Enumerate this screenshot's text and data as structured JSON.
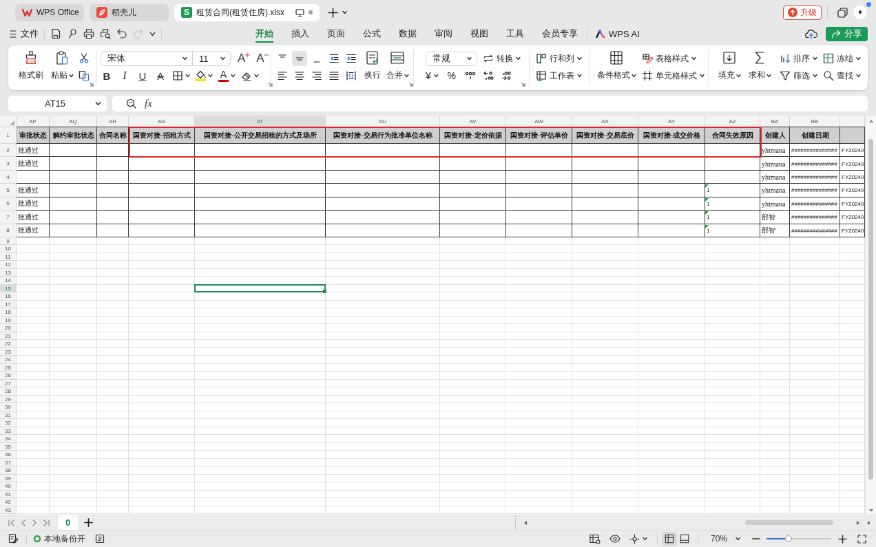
{
  "app_tabs": [
    {
      "kind": "wps",
      "label": "WPS Office",
      "selected": false
    },
    {
      "kind": "docer",
      "label": "稻壳儿",
      "selected": false
    },
    {
      "kind": "sheet",
      "icon_text": "S",
      "label": "租赁合同(租赁住房).xlsx",
      "selected": true
    }
  ],
  "account": {
    "upgrade": "升级"
  },
  "menu": {
    "file": "文件",
    "redo_disabled": true,
    "tabs": [
      {
        "label": "开始",
        "selected": true
      },
      {
        "label": "插入",
        "selected": false
      },
      {
        "label": "页面",
        "selected": false
      },
      {
        "label": "公式",
        "selected": false
      },
      {
        "label": "数据",
        "selected": false
      },
      {
        "label": "审阅",
        "selected": false
      },
      {
        "label": "视图",
        "selected": false
      },
      {
        "label": "工具",
        "selected": false
      },
      {
        "label": "会员专享",
        "selected": false
      }
    ],
    "ai": "WPS AI",
    "share": "分享"
  },
  "ribbon": {
    "format_painter": "格式刷",
    "paste": "粘贴",
    "font_name": "宋体",
    "font_size": "11",
    "grow_font": "A",
    "shrink_font": "A",
    "bold": "B",
    "italic": "I",
    "underline": "U",
    "strikethrough": "A",
    "font_color": "A",
    "vertical_align": [
      {
        "kind": "top",
        "selected": false
      },
      {
        "kind": "middle",
        "selected": true
      },
      {
        "kind": "bottom",
        "selected": false
      }
    ],
    "wrap_text": "换行",
    "merge": "合并",
    "number_format": "常规",
    "convert": "转换",
    "currency": "¥",
    "percent": "%",
    "rows_columns": "行和列",
    "worksheet": "工作表",
    "conditional_format": "条件格式",
    "table_style": "表格样式",
    "cell_style": "单元格样式",
    "fill": "填充",
    "sum": "求和",
    "sort": "排序",
    "filter": "筛选",
    "freeze": "冻结",
    "find": "查找"
  },
  "formula_bar": {
    "name_box": "AT15",
    "fx": "fx"
  },
  "sheet": {
    "columns": [
      {
        "label": "AP",
        "selected": false
      },
      {
        "label": "AQ",
        "selected": false
      },
      {
        "label": "AR",
        "selected": false
      },
      {
        "label": "AS",
        "selected": false
      },
      {
        "label": "AT",
        "selected": true
      },
      {
        "label": "AU",
        "selected": false
      },
      {
        "label": "AV",
        "selected": false
      },
      {
        "label": "AW",
        "selected": false
      },
      {
        "label": "AX",
        "selected": false
      },
      {
        "label": "AY",
        "selected": false
      },
      {
        "label": "AZ",
        "selected": false
      },
      {
        "label": "BA",
        "selected": false
      },
      {
        "label": "BB",
        "selected": false
      },
      {
        "selected": false
      }
    ],
    "row_numbers": [
      {
        "label": "1",
        "selected": false
      },
      {
        "label": "2",
        "selected": false
      },
      {
        "label": "3",
        "selected": false
      },
      {
        "label": "4",
        "selected": false
      },
      {
        "label": "5",
        "selected": false
      },
      {
        "label": "6",
        "selected": false
      },
      {
        "label": "7",
        "selected": false
      },
      {
        "label": "8",
        "selected": false
      },
      {
        "label": "9",
        "selected": false
      },
      {
        "label": "10",
        "selected": false
      },
      {
        "label": "11",
        "selected": false
      },
      {
        "label": "12",
        "selected": false
      },
      {
        "label": "13",
        "selected": false
      },
      {
        "label": "14",
        "selected": false
      },
      {
        "label": "15",
        "selected": true
      },
      {
        "label": "16",
        "selected": false
      },
      {
        "label": "17",
        "selected": false
      },
      {
        "label": "18",
        "selected": false
      },
      {
        "label": "19",
        "selected": false
      },
      {
        "label": "20",
        "selected": false
      },
      {
        "label": "21",
        "selected": false
      },
      {
        "label": "22",
        "selected": false
      },
      {
        "label": "23",
        "selected": false
      },
      {
        "label": "24",
        "selected": false
      },
      {
        "label": "25",
        "selected": false
      },
      {
        "label": "26",
        "selected": false
      },
      {
        "label": "27",
        "selected": false
      },
      {
        "label": "28",
        "selected": false
      },
      {
        "label": "29",
        "selected": false
      },
      {
        "label": "30",
        "selected": false
      },
      {
        "label": "31",
        "selected": false
      },
      {
        "label": "32",
        "selected": false
      },
      {
        "label": "33",
        "selected": false
      },
      {
        "label": "34",
        "selected": false
      },
      {
        "label": "35",
        "selected": false
      },
      {
        "label": "36",
        "selected": false
      },
      {
        "label": "37",
        "selected": false
      },
      {
        "label": "38",
        "selected": false
      },
      {
        "label": "39",
        "selected": false
      },
      {
        "label": "40",
        "selected": false
      },
      {
        "label": "41",
        "selected": false
      },
      {
        "label": "42",
        "selected": false
      },
      {
        "label": "43",
        "selected": false
      }
    ],
    "rows": [
      {
        "kind": "header",
        "cells": [
          "审批状态",
          "解约审批状态",
          "合同名称",
          "国资对接-招租方式",
          "国资对接-公开交易招租的方式及场所",
          "国资对接-交易行为批准单位名称",
          "国资对接-定价依据",
          "国资对接-评估单价",
          "国资对接-交易底价",
          "国资对接-成交价格",
          "合同失效原因",
          "创建人",
          "创建日期",
          null
        ]
      },
      {
        "kind": "data",
        "cells": [
          "批通过",
          null,
          null,
          null,
          null,
          null,
          null,
          null,
          null,
          null,
          null,
          "yhtmana",
          "###############",
          "FY20240"
        ]
      },
      {
        "kind": "data",
        "cells": [
          "批通过",
          null,
          null,
          null,
          null,
          null,
          null,
          null,
          null,
          null,
          null,
          "yhtmana",
          "###############",
          "FY20240"
        ]
      },
      {
        "kind": "data",
        "cells": [
          null,
          null,
          null,
          null,
          null,
          null,
          null,
          null,
          null,
          null,
          null,
          "yhtmana",
          "###############",
          "FY20240"
        ]
      },
      {
        "kind": "data",
        "cells": [
          "批通过",
          null,
          null,
          null,
          null,
          null,
          null,
          null,
          null,
          null,
          {
            "text": "1",
            "marked": true
          },
          "yhtmana",
          "###############",
          "FY20240"
        ]
      },
      {
        "kind": "data",
        "cells": [
          "批通过",
          null,
          null,
          null,
          null,
          null,
          null,
          null,
          null,
          null,
          {
            "text": "1",
            "marked": true
          },
          "yhtmana",
          "###############",
          "FY20240"
        ]
      },
      {
        "kind": "data",
        "cells": [
          "批通过",
          null,
          null,
          null,
          null,
          null,
          null,
          null,
          null,
          null,
          {
            "text": "1",
            "marked": true
          },
          "部智",
          "###############",
          "FY20240"
        ]
      },
      {
        "kind": "data",
        "cells": [
          "批通过",
          null,
          null,
          null,
          null,
          null,
          null,
          null,
          null,
          null,
          {
            "text": "1",
            "marked": true
          },
          "部智",
          "###############",
          "FY20240"
        ]
      }
    ],
    "annotation": {
      "kind": "frame"
    }
  },
  "sheet_tabs": [
    {
      "label": "0",
      "selected": true
    }
  ],
  "status_bar": {
    "backup_on": true,
    "backup": "本地备份开",
    "view_modes": [
      {
        "kind": "normal",
        "selected": true
      },
      {
        "kind": "page",
        "selected": false
      }
    ],
    "zoom": "70%",
    "zoom_slider": {
      "level": 0.34
    }
  }
}
